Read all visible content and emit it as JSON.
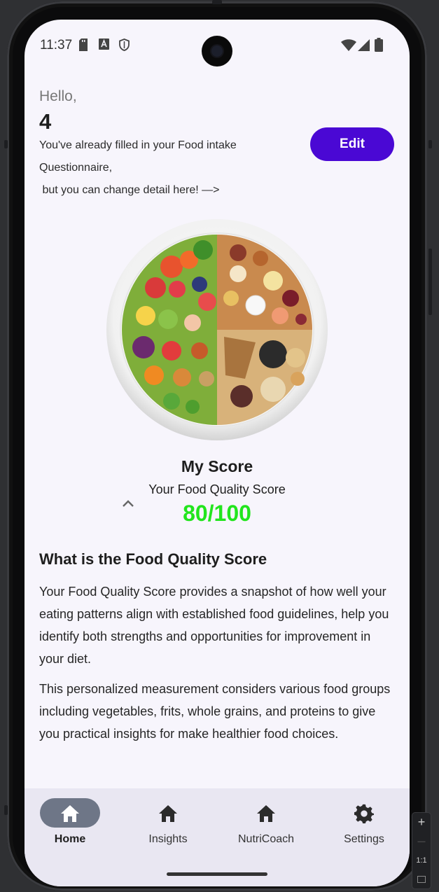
{
  "status": {
    "time": "11:37",
    "left_icons": [
      "sd-card-icon",
      "a-box-icon",
      "shield-icon"
    ],
    "right_icons": [
      "wifi-icon",
      "signal-icon",
      "battery-icon"
    ]
  },
  "greeting": {
    "hello": "Hello,",
    "name": "4",
    "message_line1": "You've already filled in your Food intake",
    "message_line2": "Questionnaire,",
    "message_line3": " but you can change detail here! —>",
    "edit_label": "Edit"
  },
  "image": {
    "description_icon": "food-plate-image"
  },
  "score": {
    "title": "My Score",
    "subtitle": "Your Food Quality Score",
    "value": "80/100",
    "value_color": "#22e51d"
  },
  "info": {
    "title": "What is the Food Quality Score",
    "para1": "Your Food Quality Score provides a snapshot of how well your eating patterns align with established food guidelines, help you identify both strengths and opportunities for improvement in your diet.",
    "para2": "This personalized measurement considers various food groups including vegetables, frits, whole grains, and proteins to give you practical insights for make healthier food choices."
  },
  "nav": {
    "items": [
      {
        "label": "Home",
        "icon": "home-icon",
        "active": true
      },
      {
        "label": "Insights",
        "icon": "home-icon",
        "active": false
      },
      {
        "label": "NutriCoach",
        "icon": "home-icon",
        "active": false
      },
      {
        "label": "Settings",
        "icon": "gear-icon",
        "active": false
      }
    ]
  },
  "emulator_zoom": {
    "plus": "+",
    "minus": "—",
    "ratio": "1:1"
  },
  "colors": {
    "accent": "#4a08d4",
    "score": "#22e51d",
    "nav_bg": "#e9e7f2"
  }
}
